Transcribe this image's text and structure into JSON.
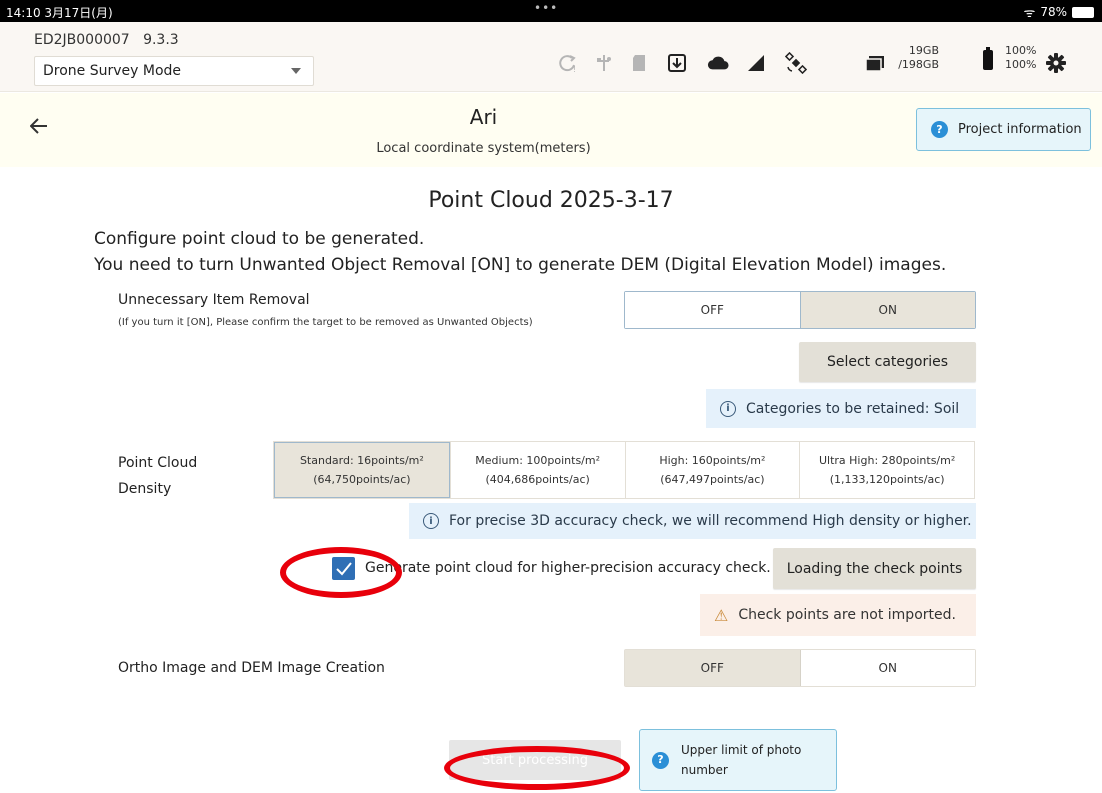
{
  "status_bar": {
    "time": "14:10  3月17日(月)",
    "dots": "•••",
    "wifi": "ᯤ",
    "battery_pct": "78%"
  },
  "toolbar": {
    "device_id": "ED2JB000007",
    "version": "9.3.3",
    "mode": "Drone Survey Mode",
    "storage_used": "19GB",
    "storage_total": "/198GB",
    "battery_a": "100%",
    "battery_b": "100%",
    "icons": [
      "sync-icon",
      "usb-icon",
      "sd-card-icon",
      "download-icon",
      "cloud-icon",
      "signal-icon",
      "satellite-icon",
      "folder-icon",
      "battery-icon",
      "gear-icon"
    ]
  },
  "project": {
    "title": "Ari",
    "subtitle": "Local coordinate system(meters)",
    "info_button": "Project information"
  },
  "section_title": "Point Cloud 2025-3-17",
  "intro_line1": "Configure point cloud to be generated.",
  "intro_line2": "You need to turn Unwanted Object Removal [ON] to generate DEM (Digital Elevation Model) images.",
  "removal": {
    "label": "Unnecessary Item Removal",
    "note": "(If you turn it [ON], Please confirm the target to be removed as Unwanted Objects)",
    "off": "OFF",
    "on": "ON",
    "selected": "ON",
    "select_categories": "Select categories",
    "retained_info": "Categories to be retained: Soil"
  },
  "density": {
    "label_line1": "Point Cloud",
    "label_line2": "Density",
    "selected": "Standard",
    "options": [
      {
        "line1": "Standard: 16points/m²",
        "line2": "(64,750points/ac)"
      },
      {
        "line1": "Medium: 100points/m²",
        "line2": "(404,686points/ac)"
      },
      {
        "line1": "High: 160points/m²",
        "line2": "(647,497points/ac)"
      },
      {
        "line1": "Ultra High: 280points/m²",
        "line2": "(1,133,120points/ac)"
      }
    ],
    "info": "For precise 3D accuracy check, we will recommend High density or higher."
  },
  "accuracy": {
    "checkbox_label": "Generate point cloud for higher-precision accuracy check.",
    "checked": true,
    "load_button": "Loading the check points",
    "warning": "Check points are not imported."
  },
  "ortho": {
    "label": "Ortho Image and DEM Image Creation",
    "off": "OFF",
    "on": "ON",
    "selected": "OFF"
  },
  "footer": {
    "start_button": "Start processing",
    "limit_info": "Upper limit of photo number"
  },
  "colors": {
    "highlight_ring": "#e8000b",
    "header_bg": "#fffef2",
    "info_bg": "#e5f1fb",
    "warn_bg": "#fbefe8",
    "checkbox": "#2f6fb5"
  }
}
